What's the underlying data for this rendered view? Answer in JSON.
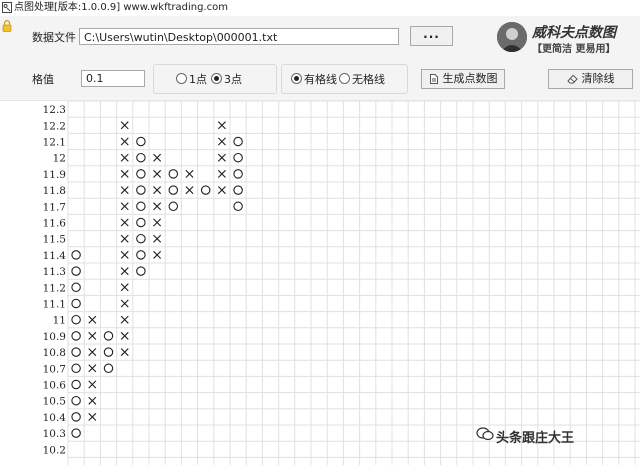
{
  "window": {
    "title": "点图处理[版本:1.0.0.9] www.wkftrading.com"
  },
  "toolbar": {
    "file_label": "数据文件",
    "file_path": "C:\\Users\\wutin\\Desktop\\000001.txt",
    "browse_label": "...",
    "grid_label": "格值",
    "grid_value": "0.1",
    "reversal_options": [
      {
        "label": "1点",
        "checked": false
      },
      {
        "label": "3点",
        "checked": true
      }
    ],
    "gridline_options": [
      {
        "label": "有格线",
        "checked": true
      },
      {
        "label": "无格线",
        "checked": false
      }
    ],
    "generate_label": "生成点数图",
    "clear_label": "清除线"
  },
  "brand": {
    "name": "威科夫点数图",
    "slogan": "【更简洁 更易用】"
  },
  "watermark": {
    "text": "头条跟庄大王"
  },
  "colors": {
    "panel_bg": "#f4f4f4",
    "grid_line": "#e0e0e0",
    "mark": "#222222"
  },
  "chart_data": {
    "type": "table",
    "prices": [
      "12.3",
      "12.2",
      "12.1",
      "12",
      "11.9",
      "11.8",
      "11.7",
      "11.6",
      "11.5",
      "11.4",
      "11.3",
      "11.2",
      "11.1",
      "11",
      "10.9",
      "10.8",
      "10.7",
      "10.6",
      "10.5",
      "10.4",
      "10.3",
      "10.2"
    ],
    "columns": [
      {
        "mark": "O",
        "high": "11.4",
        "low": "10.3"
      },
      {
        "mark": "X",
        "high": "11",
        "low": "10.4"
      },
      {
        "mark": "O",
        "high": "10.9",
        "low": "10.7"
      },
      {
        "mark": "X",
        "high": "12.2",
        "low": "10.8"
      },
      {
        "mark": "O",
        "high": "12.1",
        "low": "11.3"
      },
      {
        "mark": "X",
        "high": "12",
        "low": "11.4"
      },
      {
        "mark": "O",
        "high": "11.9",
        "low": "11.7"
      },
      {
        "mark": "X",
        "high": "11.9",
        "low": "11.8"
      },
      {
        "mark": "O",
        "high": "11.8",
        "low": "11.8"
      },
      {
        "mark": "X",
        "high": "12.2",
        "low": "11.8"
      },
      {
        "mark": "O",
        "high": "12.1",
        "low": "11.7"
      }
    ]
  }
}
